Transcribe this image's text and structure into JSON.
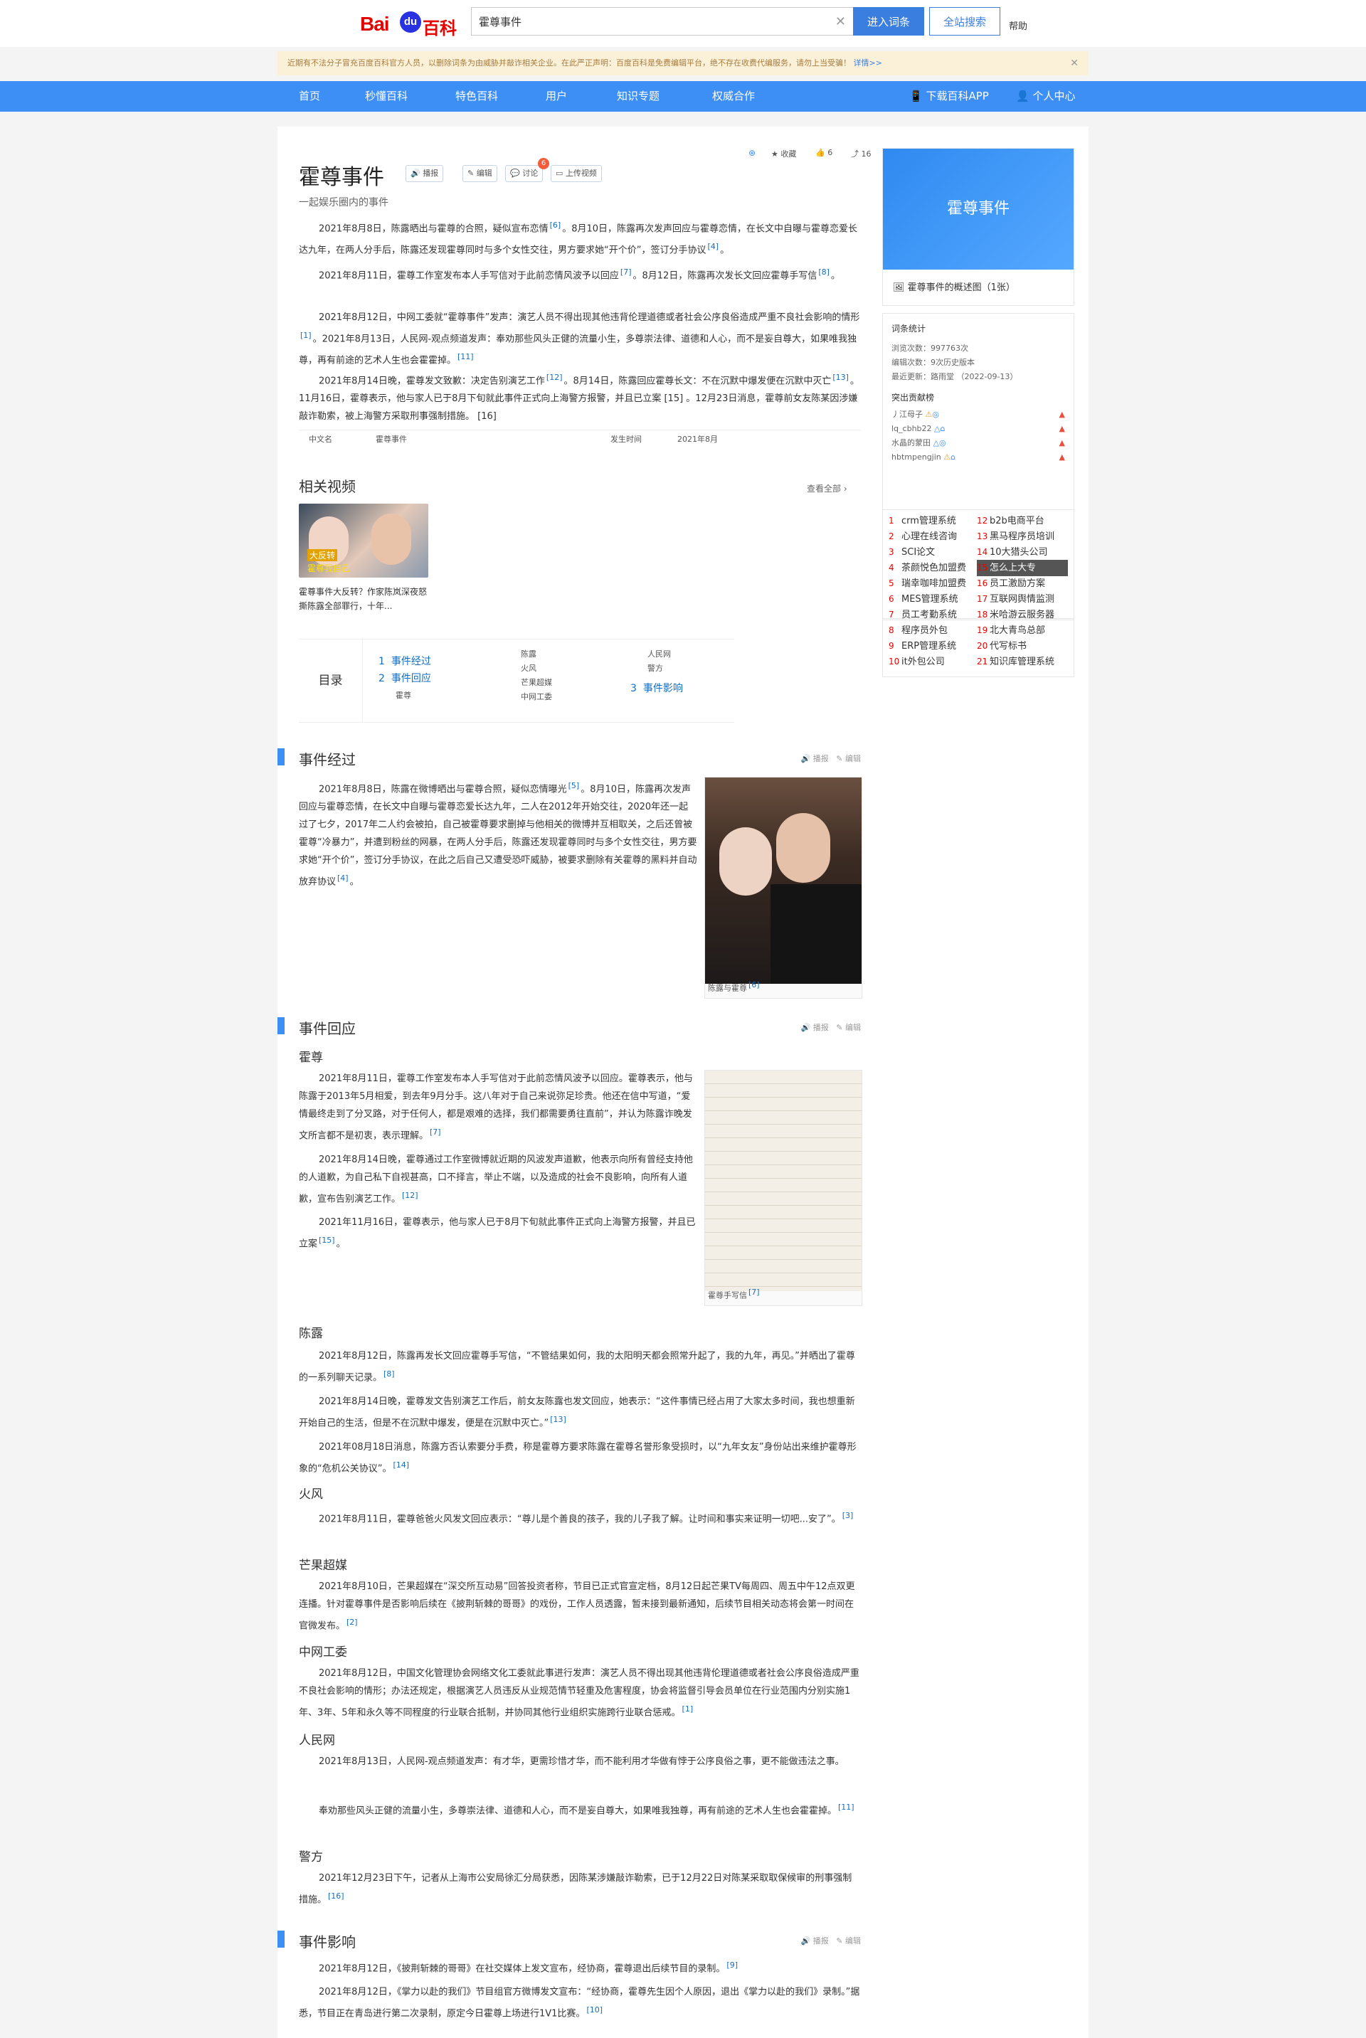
{
  "header": {
    "logo_text": "Bai",
    "logo_paw": "du",
    "logo_baike": "百科",
    "search_value": "霍尊事件",
    "entry_button": "进入词条",
    "site_button": "全站搜索",
    "help": "帮助"
  },
  "notice": {
    "text": "近期有不法分子冒充百度百科官方人员，以删除词条为由威胁并敲诈相关企业。在此严正声明：百度百科是免费编辑平台，绝不存在收费代编服务，请勿上当受骗！",
    "more": "详情>>"
  },
  "nav": {
    "items": [
      "首页",
      "秒懂百科",
      "特色百科",
      "用户",
      "知识专题",
      "权威合作"
    ],
    "app": "下载百科APP",
    "user": "个人中心"
  },
  "article": {
    "title": "霍尊事件",
    "tools": [
      "播报",
      "编辑",
      "讨论",
      "上传视频"
    ],
    "discuss_badge": "6",
    "collect": "收藏",
    "likes": "6",
    "shares": "16",
    "subtitle": "一起娱乐圈内的事件",
    "summary": [
      {
        "text": "2021年8月8日，陈露晒出与霍尊的合照，疑似宣布恋情",
        "ref": "[6]",
        "text2": "。8月10日，陈露再次发声回应与霍尊恋情，在长文中自曝与霍尊恋爱长达九年，在两人分手后，陈露还发现霍尊同时与多个女性交往，男方要求她“开个价”，签订分手协议",
        "ref2": "[4]",
        "end": "。"
      },
      {
        "text": "2021年8月11日，霍尊工作室发布本人手写信对于此前恋情风波予以回应",
        "ref": "[7]",
        "text2": "。8月12日，陈露再次发长文回应霍尊手写信",
        "ref2": "[8]",
        "end": "。"
      },
      {
        "text": "2021年8月12日，中网工委就“霍尊事件”发声：演艺人员不得出现其他违背伦理道德或者社会公序良俗造成严重不良社会影响的情形",
        "ref": "[1]",
        "text2": "。2021年8月13日，人民网-观点频道发声：奉劝那些风头正健的流量小生，多尊崇法律、道德和人心，而不是妄自尊大，如果唯我独尊，再有前途的艺术人生也会霍霍掉。",
        "ref2": "[11]",
        "end": ""
      },
      {
        "text": "2021年8月14日晚，霍尊发文致歉：决定告别演艺工作",
        "ref": "[12]",
        "text2": "。8月14日，陈露回应霍尊长文：不在沉默中爆发便在沉默中灭亡",
        "ref2": "[13]",
        "end": "。11月16日，霍尊表示，他与家人已于8月下旬就此事件正式向上海警方报警，并且已立案 [15] 。12月23日消息，霍尊前女友陈某因涉嫌敲诈勒索，被上海警方采取刑事强制措施。 [16]"
      }
    ],
    "infobox": {
      "k1": "中文名",
      "v1": "霍尊事件",
      "k2": "发生时间",
      "v2": "2021年8月"
    },
    "videos": {
      "title": "相关视频",
      "more": "查看全部",
      "overlay": "大反转",
      "overlay2": "霍尊我自己",
      "caption": "霍尊事件大反转？作家陈岚深夜怒撕陈露全部罪行，十年..."
    },
    "toc": {
      "label": "目录",
      "items": [
        {
          "num": "1",
          "text": "事件经过"
        },
        {
          "num": "2",
          "text": "事件回应"
        },
        {
          "num": "3",
          "text": "事件影响"
        }
      ],
      "subs_a": [
        "霍尊"
      ],
      "subs_b": [
        "陈露",
        "火风",
        "芒果超媒",
        "中网工委"
      ],
      "subs_c": [
        "人民网",
        "警方"
      ]
    }
  },
  "sections": {
    "ops_report": "播报",
    "ops_edit": "编辑",
    "s1": {
      "title": "事件经过",
      "para": "2021年8月8日，陈露在微博晒出与霍尊合照，疑似恋情曝光",
      "ref": "[5]",
      "para2": "。8月10日，陈露再次发声回应与霍尊恋情，在长文中自曝与霍尊恋爱长达九年，二人在2012年开始交往，2020年还一起过了七夕，2017年二人约会被拍，自己被霍尊要求删掉与他相关的微博并互相取关，之后还曾被霍尊“冷暴力”，并遭到粉丝的网暴，在两人分手后，陈露还发现霍尊同时与多个女性交往，男方要求她“开个价”，签订分手协议，在此之后自己又遭受恐吓威胁，被要求删除有关霍尊的黑料并自动放弃协议",
      "ref2": "[4]",
      "photo_caption": "陈露与霍尊",
      "photo_ref": "[6]"
    },
    "s2": {
      "title": "事件回应",
      "huozun": {
        "title": "霍尊",
        "p1": "2021年8月11日，霍尊工作室发布本人手写信对于此前恋情风波予以回应。霍尊表示，他与陈露于2013年5月相爱，到去年9月分手。这八年对于自己来说弥足珍贵。他还在信中写道，“爱情最终走到了分叉路，对于任何人，都是艰难的选择，我们都需要勇往直前”，并认为陈露诈晚发文所言都不是初衷，表示理解。",
        "r1": "[7]",
        "p2": "2021年8月14日晚，霍尊通过工作室微博就近期的风波发声道歉，他表示向所有曾经支持他的人道歉，为自己私下自视甚高，口不择言，举止不端，以及造成的社会不良影响，向所有人道歉，宣布告别演艺工作。",
        "r2": "[12]",
        "p3": "2021年11月16日，霍尊表示，他与家人已于8月下旬就此事件正式向上海警方报警，并且已立案",
        "r3": "[15]",
        "photo_caption": "霍尊手写信",
        "photo_ref": "[7]"
      },
      "chenlu": {
        "title": "陈露",
        "p1": "2021年8月12日，陈露再发长文回应霍尊手写信，“不管结果如何，我的太阳明天都会照常升起了，我的九年，再见。”并晒出了霍尊的一系列聊天记录。",
        "r1": "[8]",
        "p2": "2021年8月14日晚，霍尊发文告别演艺工作后，前女友陈露也发文回应，她表示：“这件事情已经占用了大家太多时间，我也想重新开始自己的生活，但是不在沉默中爆发，便是在沉默中灭亡。”",
        "r2": "[13]",
        "p3": "2021年08月18日消息，陈露方否认索要分手费，称是霍尊方要求陈露在霍尊名誉形象受损时，以“九年女友”身份站出来维护霍尊形象的“危机公关协议”。",
        "r3": "[14]"
      },
      "huofeng": {
        "title": "火风",
        "p1": "2021年8月11日，霍尊爸爸火风发文回应表示：“尊儿是个善良的孩子，我的儿子我了解。让时间和事实来证明一切吧...安了”。",
        "r1": "[3]"
      },
      "mango": {
        "title": "芒果超媒",
        "p1": "2021年8月10日，芒果超媒在“深交所互动易”回答投资者称，节目已正式官宣定档，8月12日起芒果TV每周四、周五中午12点双更连播。针对霍尊事件是否影响后续在《披荆斩棘的哥哥》的戏份，工作人员透露，暂未接到最新通知，后续节目相关动态将会第一时间在官微发布。",
        "r1": "[2]"
      },
      "zwgw": {
        "title": "中网工委",
        "p1": "2021年8月12日，中国文化管理协会网络文化工委就此事进行发声：演艺人员不得出现其他违背伦理道德或者社会公序良俗造成严重不良社会影响的情形；办法还规定，根据演艺人员违反从业规范情节轻重及危害程度，协会将监督引导会员单位在行业范围内分别实施1年、3年、5年和永久等不同程度的行业联合抵制，并协同其他行业组织实施跨行业联合惩戒。",
        "r1": "[1]"
      },
      "rmw": {
        "title": "人民网",
        "p1": "2021年8月13日，人民网-观点频道发声：有才华，更需珍惜才华，而不能利用才华做有悖于公序良俗之事，更不能做违法之事。",
        "p2": "奉劝那些风头正健的流量小生，多尊崇法律、道德和人心，而不是妄自尊大，如果唯我独尊，再有前途的艺术人生也会霍霍掉。",
        "r2": "[11]"
      },
      "police": {
        "title": "警方",
        "p1": "2021年12月23日下午，记者从上海市公安局徐汇分局获悉，因陈某涉嫌敲诈勒索，已于12月22日对陈某采取取保候审的刑事强制措施。",
        "r1": "[16]"
      }
    },
    "s3": {
      "title": "事件影响",
      "p1": "2021年8月12日，《披荆斩棘的哥哥》在社交媒体上发文宣布，经协商，霍尊退出后续节目的录制。",
      "r1": "[9]",
      "p2": "2021年8月12日，《掌力以赴的我们》节目组官方微博发文宣布：“经协商，霍尊先生因个人原因，退出《掌力以赴的我们》录制。”据悉，节目正在青岛进行第二次录制，原定今日霍尊上场进行1V1比赛。",
      "r2": "[10]"
    }
  },
  "sidebar": {
    "cover_title": "霍尊事件",
    "overview": "霍尊事件的概述图（1张）",
    "stats_title": "词条统计",
    "views": "浏览次数：997763次",
    "edits": "编辑次数：9次历史版本",
    "updated": "最近更新：路雨堂 （2022-09-13）",
    "contrib_title": "突出贡献榜",
    "contributors": [
      "丿江母子",
      "lq_cbhb22",
      "水晶的蒙田",
      "hbtmpengjin"
    ],
    "ranks": [
      {
        "n": "1",
        "t": "crm管理系统"
      },
      {
        "n": "12",
        "t": "b2b电商平台"
      },
      {
        "n": "2",
        "t": "心理在线咨询"
      },
      {
        "n": "13",
        "t": "黑马程序员培训"
      },
      {
        "n": "3",
        "t": "SCI论文"
      },
      {
        "n": "14",
        "t": "10大猎头公司"
      },
      {
        "n": "4",
        "t": "茶颜悦色加盟费"
      },
      {
        "n": "15",
        "t": "怎么上大专"
      },
      {
        "n": "5",
        "t": "瑞幸咖啡加盟费"
      },
      {
        "n": "16",
        "t": "员工激励方案"
      },
      {
        "n": "6",
        "t": "MES管理系统"
      },
      {
        "n": "17",
        "t": "互联网舆情监测"
      },
      {
        "n": "7",
        "t": "员工考勤系统"
      },
      {
        "n": "18",
        "t": "米哈游云服务器"
      },
      {
        "n": "8",
        "t": "程序员外包"
      },
      {
        "n": "19",
        "t": "北大青鸟总部"
      },
      {
        "n": "9",
        "t": "ERP管理系统"
      },
      {
        "n": "20",
        "t": "代写标书"
      },
      {
        "n": "10",
        "t": "it外包公司"
      },
      {
        "n": "21",
        "t": "知识库管理系统"
      }
    ]
  }
}
